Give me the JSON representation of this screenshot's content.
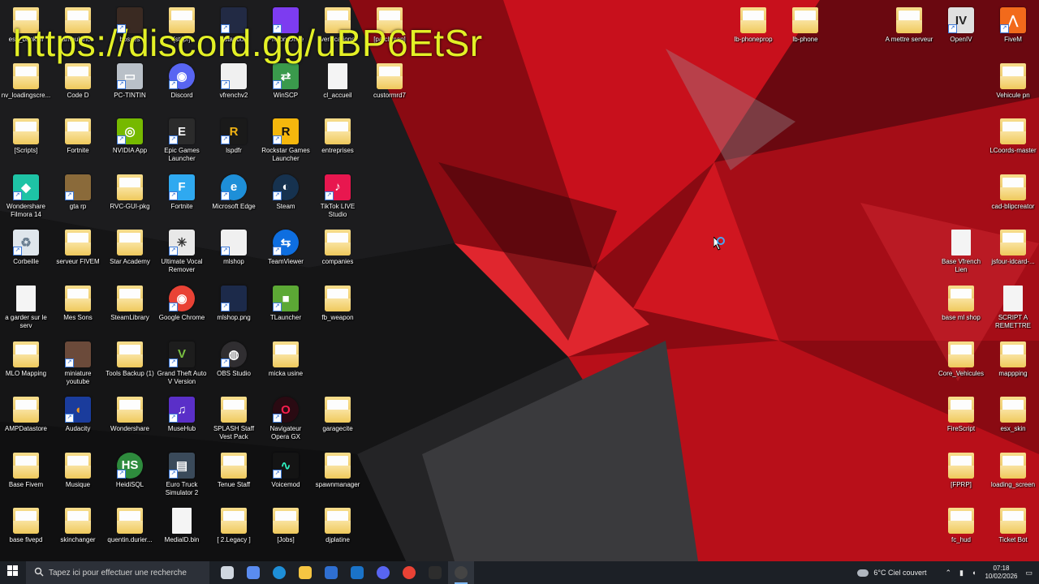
{
  "overlay": {
    "link_text": "https://discord.gg/uBP6EtSr"
  },
  "colors": {
    "overlay": "#e3f026",
    "taskbar": "#1c2026",
    "folder": "#efc95c",
    "wallpaper_red": "#c8101c"
  },
  "desktop": {
    "icons": [
      {
        "label": "esx_bankthi",
        "type": "folder",
        "col": 0,
        "row": 0
      },
      {
        "label": "ambulance",
        "type": "folder",
        "col": 1,
        "row": 0
      },
      {
        "label": "bosses",
        "type": "app",
        "color": "#3a2a22",
        "col": 2,
        "row": 0
      },
      {
        "label": "[stilpf]",
        "type": "folder",
        "col": 3,
        "row": 0
      },
      {
        "label": "Istanbul",
        "type": "app",
        "color": "#222a44",
        "col": 4,
        "row": 0
      },
      {
        "label": "Proton Drive",
        "type": "app",
        "color": "#7d3cf0",
        "col": 5,
        "row": 0
      },
      {
        "label": "verifications",
        "type": "folder",
        "col": 6,
        "row": 0
      },
      {
        "label": "[patchmap]",
        "type": "folder",
        "col": 7,
        "row": 0
      },
      {
        "label": "nv_loadingscre...",
        "type": "folder",
        "col": 0,
        "row": 1
      },
      {
        "label": "Code D",
        "type": "folder",
        "col": 1,
        "row": 1
      },
      {
        "label": "PC-TINTIN",
        "type": "app",
        "color": "#b9c0c8",
        "glyph": "▭",
        "col": 2,
        "row": 1
      },
      {
        "label": "Discord",
        "type": "app",
        "color": "#5865f2",
        "glyph": "◉",
        "round": true,
        "col": 3,
        "row": 1
      },
      {
        "label": "vfrenchv2",
        "type": "app",
        "color": "#f0f0f0",
        "col": 4,
        "row": 1
      },
      {
        "label": "WinSCP",
        "type": "app",
        "color": "#3a9a4c",
        "glyph": "⇄",
        "col": 5,
        "row": 1
      },
      {
        "label": "cl_accueil",
        "type": "doc",
        "col": 6,
        "row": 1
      },
      {
        "label": "custormrd7",
        "type": "folder",
        "col": 7,
        "row": 1
      },
      {
        "label": "[Scripts]",
        "type": "folder",
        "col": 0,
        "row": 2
      },
      {
        "label": "Fortnite",
        "type": "folder",
        "col": 1,
        "row": 2
      },
      {
        "label": "NVIDIA App",
        "type": "app",
        "color": "#76b900",
        "glyph": "◎",
        "col": 2,
        "row": 2
      },
      {
        "label": "Epic Games Launcher",
        "type": "app",
        "color": "#2b2b2b",
        "glyph": "E",
        "col": 3,
        "row": 2
      },
      {
        "label": "lspdfr",
        "type": "app",
        "color": "#1a1a1a",
        "glyph": "R",
        "glyph_color": "#f2b414",
        "col": 4,
        "row": 2
      },
      {
        "label": "Rockstar Games Launcher",
        "type": "app",
        "color": "#f5b70d",
        "glyph": "R",
        "glyph_color": "#111",
        "col": 5,
        "row": 2
      },
      {
        "label": "entreprises",
        "type": "folder",
        "col": 6,
        "row": 2
      },
      {
        "label": "Wondershare Filmora 14",
        "type": "app",
        "color": "#1ec3a5",
        "glyph": "◆",
        "col": 0,
        "row": 3
      },
      {
        "label": "gta rp",
        "type": "app",
        "color": "#8a6a3a",
        "col": 1,
        "row": 3
      },
      {
        "label": "RVC-GUI-pkg",
        "type": "folder",
        "col": 2,
        "row": 3
      },
      {
        "label": "Fortnite",
        "type": "app",
        "color": "#2fa9f0",
        "glyph": "F",
        "col": 3,
        "row": 3
      },
      {
        "label": "Microsoft Edge",
        "type": "app",
        "color": "#1e8fd8",
        "glyph": "e",
        "round": true,
        "col": 4,
        "row": 3
      },
      {
        "label": "Steam",
        "type": "app",
        "color": "#16324f",
        "glyph": "◐",
        "round": true,
        "col": 5,
        "row": 3
      },
      {
        "label": "TikTok LIVE Studio",
        "type": "app",
        "color": "#e8174f",
        "glyph": "♪",
        "col": 6,
        "row": 3
      },
      {
        "label": "Corbeille",
        "type": "app",
        "color": "#dfe6ec",
        "glyph": "♻",
        "glyph_color": "#6a7e90",
        "col": 0,
        "row": 4
      },
      {
        "label": "serveur FIVEM",
        "type": "folder",
        "col": 1,
        "row": 4
      },
      {
        "label": "Star Academy",
        "type": "folder",
        "col": 2,
        "row": 4
      },
      {
        "label": "Ultimate Vocal Remover",
        "type": "app",
        "color": "#e8e8e8",
        "glyph": "✳",
        "glyph_color": "#333",
        "col": 3,
        "row": 4
      },
      {
        "label": "mlshop",
        "type": "app",
        "color": "#f0f0f0",
        "col": 4,
        "row": 4
      },
      {
        "label": "TeamViewer",
        "type": "app",
        "color": "#0e6ee0",
        "glyph": "⇆",
        "round": true,
        "col": 5,
        "row": 4
      },
      {
        "label": "companies",
        "type": "folder",
        "col": 6,
        "row": 4
      },
      {
        "label": "a garder sur le serv",
        "type": "doc",
        "col": 0,
        "row": 5
      },
      {
        "label": "Mes Sons",
        "type": "folder",
        "col": 1,
        "row": 5
      },
      {
        "label": "SteamLibrary",
        "type": "folder",
        "col": 2,
        "row": 5
      },
      {
        "label": "Google Chrome",
        "type": "app",
        "color": "#e94235",
        "glyph": "◉",
        "round": true,
        "col": 3,
        "row": 5
      },
      {
        "label": "mlshop.png",
        "type": "app",
        "color": "#1c2a4a",
        "col": 4,
        "row": 5
      },
      {
        "label": "TLauncher",
        "type": "app",
        "color": "#5ca835",
        "glyph": "■",
        "col": 5,
        "row": 5
      },
      {
        "label": "fb_weapon",
        "type": "folder",
        "col": 6,
        "row": 5
      },
      {
        "label": "MLO Mapping",
        "type": "folder",
        "col": 0,
        "row": 6
      },
      {
        "label": "miniature youtube",
        "type": "app",
        "color": "#6b4a3a",
        "col": 1,
        "row": 6
      },
      {
        "label": "Tools Backup (1)",
        "type": "folder",
        "col": 2,
        "row": 6
      },
      {
        "label": "Grand Theft Auto V Version origin...",
        "type": "app",
        "color": "#1d1d1d",
        "glyph": "V",
        "glyph_color": "#7ac142",
        "col": 3,
        "row": 6
      },
      {
        "label": "OBS Studio",
        "type": "app",
        "color": "#302e31",
        "glyph": "◍",
        "round": true,
        "col": 4,
        "row": 6
      },
      {
        "label": "micka usine",
        "type": "folder",
        "col": 5,
        "row": 6
      },
      {
        "label": "AMPDatastore",
        "type": "folder",
        "col": 0,
        "row": 7
      },
      {
        "label": "Audacity",
        "type": "app",
        "color": "#1a3c9c",
        "glyph": "◖",
        "glyph_color": "#f59a1b",
        "col": 1,
        "row": 7
      },
      {
        "label": "Wondershare",
        "type": "folder",
        "col": 2,
        "row": 7
      },
      {
        "label": "MuseHub",
        "type": "app",
        "color": "#5a2fc8",
        "glyph": "♫",
        "col": 3,
        "row": 7
      },
      {
        "label": "SPLASH Staff Vest Pack",
        "type": "folder",
        "col": 4,
        "row": 7
      },
      {
        "label": "Navigateur Opera GX",
        "type": "app",
        "color": "#2a0a12",
        "glyph": "O",
        "glyph_color": "#fa1e4e",
        "round": true,
        "col": 5,
        "row": 7
      },
      {
        "label": "garagecite",
        "type": "folder",
        "col": 6,
        "row": 7
      },
      {
        "label": "Base Fivem",
        "type": "folder",
        "col": 0,
        "row": 8
      },
      {
        "label": "Musique",
        "type": "folder",
        "col": 1,
        "row": 8
      },
      {
        "label": "HeidiSQL",
        "type": "app",
        "color": "#2e8b3d",
        "glyph": "HS",
        "round": true,
        "col": 2,
        "row": 8
      },
      {
        "label": "Euro Truck Simulator 2",
        "type": "app",
        "color": "#3a4a5a",
        "glyph": "▤",
        "col": 3,
        "row": 8
      },
      {
        "label": "Tenue Staff",
        "type": "folder",
        "col": 4,
        "row": 8
      },
      {
        "label": "Voicemod",
        "type": "app",
        "color": "#141414",
        "glyph": "∿",
        "glyph_color": "#2ef0c0",
        "col": 5,
        "row": 8
      },
      {
        "label": "spawnmanager",
        "type": "folder",
        "col": 6,
        "row": 8
      },
      {
        "label": "base fivepd",
        "type": "folder",
        "col": 0,
        "row": 9
      },
      {
        "label": "skinchanger",
        "type": "folder",
        "col": 1,
        "row": 9
      },
      {
        "label": "quentin.durier...",
        "type": "folder",
        "col": 2,
        "row": 9
      },
      {
        "label": "MediaID.bin",
        "type": "doc",
        "col": 3,
        "row": 9
      },
      {
        "label": "[ 2.Legacy ]",
        "type": "folder",
        "col": 4,
        "row": 9
      },
      {
        "label": "[Jobs]",
        "type": "folder",
        "col": 5,
        "row": 9
      },
      {
        "label": "djplatine",
        "type": "folder",
        "col": 6,
        "row": 9
      }
    ],
    "right_icons": [
      {
        "label": "lb-phoneprop",
        "type": "folder",
        "pos": "r1c14"
      },
      {
        "label": "lb-phone",
        "type": "folder",
        "pos": "r1c15"
      },
      {
        "label": "A mettre serveur",
        "type": "folder",
        "pos": "r1c17"
      },
      {
        "label": "OpenIV",
        "type": "app",
        "color": "#e0e0e0",
        "glyph": "IV",
        "glyph_color": "#222",
        "pos": "r1c18"
      },
      {
        "label": "FiveM",
        "type": "app",
        "color": "#f26a1b",
        "glyph": "⋀",
        "pos": "r1c19"
      },
      {
        "label": "Vehicule pn",
        "type": "folder",
        "pos": "r2c19"
      },
      {
        "label": "LCoords-master",
        "type": "folder",
        "pos": "r3c19"
      },
      {
        "label": "cad-blipcreator",
        "type": "folder",
        "pos": "r4c19"
      },
      {
        "label": "Base Vfrench Lien",
        "type": "doc",
        "pos": "r5c18"
      },
      {
        "label": "jsfour-idcard-...",
        "type": "folder",
        "pos": "r5c19"
      },
      {
        "label": "base ml shop",
        "type": "folder",
        "pos": "r6c18"
      },
      {
        "label": "SCRIPT A REMETTRE",
        "type": "doc",
        "pos": "r6c19"
      },
      {
        "label": "Core_Vehicules",
        "type": "folder",
        "pos": "r7c18"
      },
      {
        "label": "mappping",
        "type": "folder",
        "pos": "r7c19"
      },
      {
        "label": "FireScript",
        "type": "folder",
        "pos": "r8c18"
      },
      {
        "label": "esx_skin",
        "type": "folder",
        "pos": "r8c19"
      },
      {
        "label": "[FPRP]",
        "type": "folder",
        "pos": "r9c18"
      },
      {
        "label": "loading_screen",
        "type": "folder",
        "pos": "r9c19"
      },
      {
        "label": "fc_hud",
        "type": "folder",
        "pos": "r10c18"
      },
      {
        "label": "Ticket Bot",
        "type": "folder",
        "pos": "r10c19"
      }
    ]
  },
  "taskbar": {
    "search_placeholder": "Tapez ici pour effectuer une recherche",
    "apps": [
      {
        "name": "task-view",
        "color": "#cfd6df"
      },
      {
        "name": "copilot",
        "color": "#5a8cf0"
      },
      {
        "name": "edge",
        "color": "#1e8fd8"
      },
      {
        "name": "file-explorer",
        "color": "#f5c542"
      },
      {
        "name": "store",
        "color": "#2f6fd1"
      },
      {
        "name": "outlook",
        "color": "#1a73c8"
      },
      {
        "name": "discord",
        "color": "#5865f2"
      },
      {
        "name": "chrome",
        "color": "#e94235"
      },
      {
        "name": "terminal",
        "color": "#2d2d2d"
      },
      {
        "name": "obs",
        "color": "#444",
        "active": true
      }
    ],
    "weather": "6°C  Ciel couvert",
    "time": "07:18",
    "date": "10/02/2026"
  }
}
